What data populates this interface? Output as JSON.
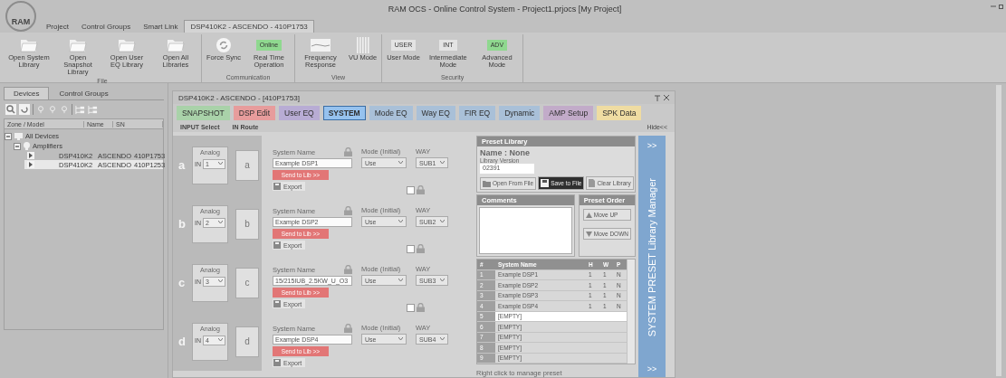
{
  "window": {
    "logo": "RAM",
    "title": "RAM OCS - Online Control System - Project1.prjocs [My Project]"
  },
  "menu_tabs": [
    {
      "label": "Project",
      "selected": false
    },
    {
      "label": "Control Groups",
      "selected": false
    },
    {
      "label": "Smart Link",
      "selected": false
    },
    {
      "label": "DSP410K2 - ASCENDO - 410P1753",
      "selected": true
    }
  ],
  "ribbon": {
    "groups": [
      {
        "label": "File",
        "buttons": [
          {
            "kind": "folder",
            "label": "Open System Library"
          },
          {
            "kind": "folder",
            "label": "Open Snapshot Library"
          },
          {
            "kind": "folder",
            "label": "Open User EQ Library"
          },
          {
            "kind": "folder",
            "label": "Open All Libraries"
          }
        ]
      },
      {
        "label": "Communication",
        "buttons": [
          {
            "kind": "sync",
            "label": "Force Sync"
          },
          {
            "kind": "badge",
            "badge": "Online",
            "color": "#8fd88f",
            "label": "Real Time Operation"
          }
        ]
      },
      {
        "label": "View",
        "buttons": [
          {
            "kind": "graph",
            "label": "Frequency Response"
          },
          {
            "kind": "meter",
            "label": "VU Mode"
          }
        ]
      },
      {
        "label": "Security",
        "buttons": [
          {
            "kind": "badge",
            "badge": "USER",
            "color": "#e4e4e4",
            "label": "User Mode"
          },
          {
            "kind": "badge",
            "badge": "INT",
            "color": "#e4e4e4",
            "label": "Intermediate Mode"
          },
          {
            "kind": "badge",
            "badge": "ADV",
            "color": "#8fd88f",
            "label": "Advanced Mode"
          }
        ]
      }
    ]
  },
  "devices": {
    "tabs": [
      {
        "label": "Devices",
        "selected": true
      },
      {
        "label": "Control Groups",
        "selected": false
      }
    ],
    "columns": [
      "Zone / Model",
      "Name",
      "SN"
    ],
    "tree": [
      {
        "kind": "root",
        "label": "All Devices",
        "expanded": true,
        "children": [
          {
            "kind": "group",
            "label": "Amplifiers",
            "expanded": true,
            "children": [
              {
                "kind": "device",
                "model": "DSP410K2",
                "name": "ASCENDO",
                "sn": "410P1753",
                "selected": false
              },
              {
                "kind": "device",
                "model": "DSP410K2",
                "name": "ASCENDO",
                "sn": "410P1253",
                "selected": true
              }
            ]
          }
        ]
      }
    ]
  },
  "dsp_window": {
    "title": "DSP410K2 - ASCENDO - [410P1753]",
    "tabs": [
      {
        "label": "SNAPSHOT",
        "color": "#a9d2a9",
        "selected": false
      },
      {
        "label": "DSP Edit",
        "color": "#e79c9c",
        "selected": false
      },
      {
        "label": "User EQ",
        "color": "#b8acd4",
        "selected": false
      },
      {
        "label": "SYSTEM",
        "color": "#96c2ee",
        "selected": true
      },
      {
        "label": "Mode EQ",
        "color": "#a9c0d8",
        "selected": false
      },
      {
        "label": "Way EQ",
        "color": "#a9c0d8",
        "selected": false
      },
      {
        "label": "FIR EQ",
        "color": "#a9c0d8",
        "selected": false
      },
      {
        "label": "Dynamic",
        "color": "#a9c0d8",
        "selected": false
      },
      {
        "label": "AMP Setup",
        "color": "#c2abc9",
        "selected": false
      },
      {
        "label": "SPK Data",
        "color": "#efdca2",
        "selected": false
      }
    ],
    "subheader": [
      "INPUT Select",
      "IN Route"
    ],
    "hide": "Hide<<",
    "channels": [
      {
        "letter": "a",
        "source": "Analog",
        "in_label": "IN",
        "input": "1",
        "output": "a",
        "name_label": "System Name",
        "name": "Example DSP1",
        "mode_label": "Mode (Initial)",
        "mode": "Use",
        "way_label": "WAY",
        "way": "SUB1",
        "send": "Send to Lib >>",
        "export": "Export",
        "linked": false
      },
      {
        "letter": "b",
        "source": "Analog",
        "in_label": "IN",
        "input": "2",
        "output": "b",
        "name_label": "System Name",
        "name": "Example DSP2",
        "mode_label": "Mode (Initial)",
        "mode": "Use",
        "way_label": "WAY",
        "way": "SUB2",
        "send": "Send to Lib >>",
        "export": "Export",
        "linked": false
      },
      {
        "letter": "c",
        "source": "Analog",
        "in_label": "IN",
        "input": "3",
        "output": "c",
        "name_label": "System Name",
        "name": "15/215IUB_2.5KW_U_O3",
        "mode_label": "Mode (Initial)",
        "mode": "Use",
        "way_label": "WAY",
        "way": "SUB3",
        "send": "Send to Lib >>",
        "export": "Export",
        "linked": false
      },
      {
        "letter": "d",
        "source": "Analog",
        "in_label": "IN",
        "input": "4",
        "output": "d",
        "name_label": "System Name",
        "name": "Example DSP4",
        "mode_label": "Mode (Initial)",
        "mode": "Use",
        "way_label": "WAY",
        "way": "SUB4",
        "send": "Send to Lib >>",
        "export": "Export"
      }
    ],
    "preset_library": {
      "title": "Preset Library",
      "name": "Name : None",
      "version_label": "Library Version",
      "version": "02391",
      "buttons": [
        {
          "kind": "folder",
          "label": "Open From File",
          "highlighted": false
        },
        {
          "kind": "save",
          "label": "Save to File",
          "highlighted": true
        },
        {
          "kind": "doc",
          "label": "Clear Library",
          "highlighted": false
        }
      ]
    },
    "comments": {
      "title": "Comments"
    },
    "preset_order": {
      "title": "Preset Order",
      "buttons": [
        {
          "kind": "up",
          "label": "Move UP"
        },
        {
          "kind": "down",
          "label": "Move DOWN"
        }
      ]
    },
    "table": {
      "columns": [
        "#",
        "System Name",
        "H",
        "W",
        "P"
      ],
      "rows": [
        {
          "cells": [
            "1",
            "Example DSP1",
            "1",
            "1",
            "N"
          ],
          "selected": false
        },
        {
          "cells": [
            "2",
            "Example DSP2",
            "1",
            "1",
            "N"
          ],
          "selected": false
        },
        {
          "cells": [
            "3",
            "Example DSP3",
            "1",
            "1",
            "N"
          ],
          "selected": false
        },
        {
          "cells": [
            "4",
            "Example DSP4",
            "1",
            "1",
            "N"
          ],
          "selected": false
        },
        {
          "cells": [
            "5",
            "[EMPTY]",
            "",
            "",
            ""
          ],
          "selected": true
        },
        {
          "cells": [
            "6",
            "[EMPTY]",
            "",
            "",
            ""
          ],
          "selected": false
        },
        {
          "cells": [
            "7",
            "[EMPTY]",
            "",
            "",
            ""
          ],
          "selected": false
        },
        {
          "cells": [
            "8",
            "[EMPTY]",
            "",
            "",
            ""
          ],
          "selected": false
        },
        {
          "cells": [
            "9",
            "[EMPTY]",
            "",
            "",
            ""
          ],
          "selected": false
        }
      ]
    },
    "hint": "Right click to manage preset",
    "side_bar": {
      "top": ">>",
      "label": "SYSTEM PRESET Library Manager",
      "bottom": ">>"
    }
  }
}
